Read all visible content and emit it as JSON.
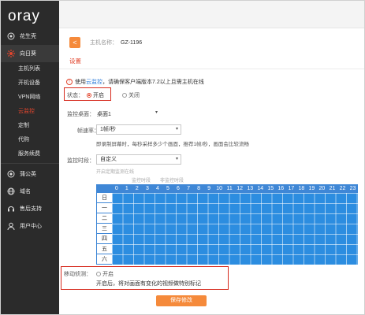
{
  "sidebar": {
    "logo": "oray",
    "groups": [
      {
        "label": "花生壳",
        "icon": "peanut-icon"
      },
      {
        "label": "向日葵",
        "icon": "sunflower-icon"
      }
    ],
    "sub_items": [
      {
        "label": "主机列表"
      },
      {
        "label": "开机设备"
      },
      {
        "label": "VPN网络"
      },
      {
        "label": "云监控"
      },
      {
        "label": "定制"
      },
      {
        "label": "代购"
      },
      {
        "label": "服务续费"
      }
    ],
    "bottom": [
      {
        "label": "蒲公英",
        "icon": "dandelion-icon"
      },
      {
        "label": "域名",
        "icon": "domain-icon"
      },
      {
        "label": "售后支持",
        "icon": "support-icon"
      },
      {
        "label": "用户中心",
        "icon": "user-icon"
      }
    ]
  },
  "header": {
    "back_symbol": "<",
    "host_label": "主机名称：",
    "host_name": "GZ-1196",
    "section_title": "设置"
  },
  "notice": {
    "pre": "使用",
    "link": "云监控",
    "post": "，请确保客户端版本7.2以上且需主机在线"
  },
  "status": {
    "label": "状态：",
    "on": "开启",
    "off": "关闭",
    "selected": "on"
  },
  "monitor_screen": {
    "label": "监控桌面：",
    "value": "桌面1"
  },
  "frame_rate": {
    "label": "帧速率：",
    "value": "1帧/秒",
    "hint": "即录制屏幕时，每秒采样多少个画面，推荐1帧/秒，画面会比较流畅"
  },
  "monitor_period": {
    "label": "监控时段：",
    "value": "自定义",
    "hint": "开启定期监测在线",
    "legend_on": "监控时段",
    "legend_off": "非监控时段"
  },
  "schedule": {
    "hours": [
      "0",
      "1",
      "2",
      "3",
      "4",
      "5",
      "6",
      "7",
      "8",
      "9",
      "10",
      "11",
      "12",
      "13",
      "14",
      "15",
      "16",
      "17",
      "18",
      "19",
      "20",
      "21",
      "22",
      "23"
    ],
    "days": [
      "日",
      "一",
      "二",
      "三",
      "四",
      "五",
      "六"
    ],
    "fill_color": "#2c8de0",
    "header_color": "#3f87d6"
  },
  "motion_detect": {
    "label": "移动侦测：",
    "option": "开启",
    "desc": "开启后，将对画面有变化的视频做特别标记"
  },
  "save_label": "保存修改",
  "colors": {
    "accent": "#f58a3b",
    "highlight": "#e2452d",
    "sidebar": "#2b2b2b",
    "annotation": "#d62a1d"
  }
}
